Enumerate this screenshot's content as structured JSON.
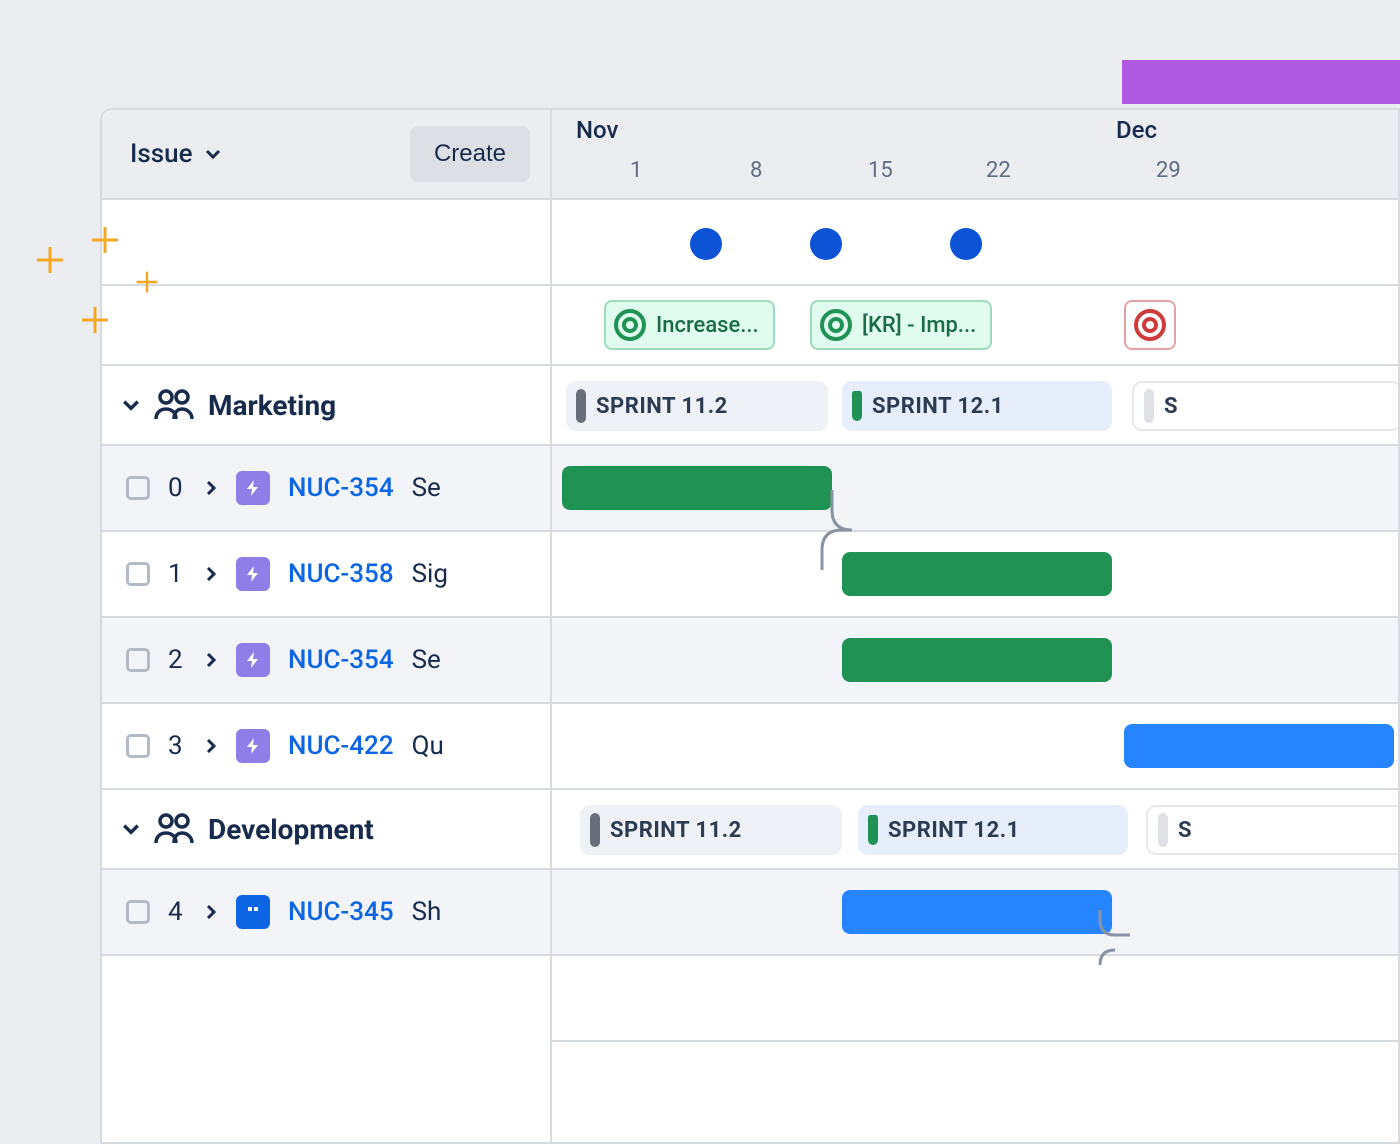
{
  "header": {
    "issue_label": "Issue",
    "create_label": "Create"
  },
  "timeline": {
    "months": [
      {
        "label": "Nov",
        "days": [
          "1",
          "8",
          "15",
          "22"
        ]
      },
      {
        "label": "Dec",
        "days": [
          "29"
        ]
      }
    ]
  },
  "goals": [
    {
      "label": "Increase...",
      "style": "green"
    },
    {
      "label": "[KR] - Imp...",
      "style": "green"
    },
    {
      "label": "",
      "style": "red"
    }
  ],
  "groups": [
    {
      "name": "Marketing",
      "sprints": [
        "SPRINT 11.2",
        "SPRINT 12.1",
        "S"
      ],
      "rows": [
        {
          "idx": "0",
          "key": "NUC-354",
          "summary": "Se",
          "type": "epic"
        },
        {
          "idx": "1",
          "key": "NUC-358",
          "summary": "Sig",
          "type": "epic"
        },
        {
          "idx": "2",
          "key": "NUC-354",
          "summary": "Se",
          "type": "epic"
        },
        {
          "idx": "3",
          "key": "NUC-422",
          "summary": "Qu",
          "type": "epic"
        }
      ]
    },
    {
      "name": "Development",
      "sprints": [
        "SPRINT 11.2",
        "SPRINT 12.1",
        "S"
      ],
      "rows": [
        {
          "idx": "4",
          "key": "NUC-345",
          "summary": "Sh",
          "type": "story"
        }
      ]
    }
  ],
  "milestone_count": 3,
  "colors": {
    "green": "#1f9254",
    "blue": "#2684ff",
    "purple": "#af59e0",
    "link": "#0c66e4"
  }
}
